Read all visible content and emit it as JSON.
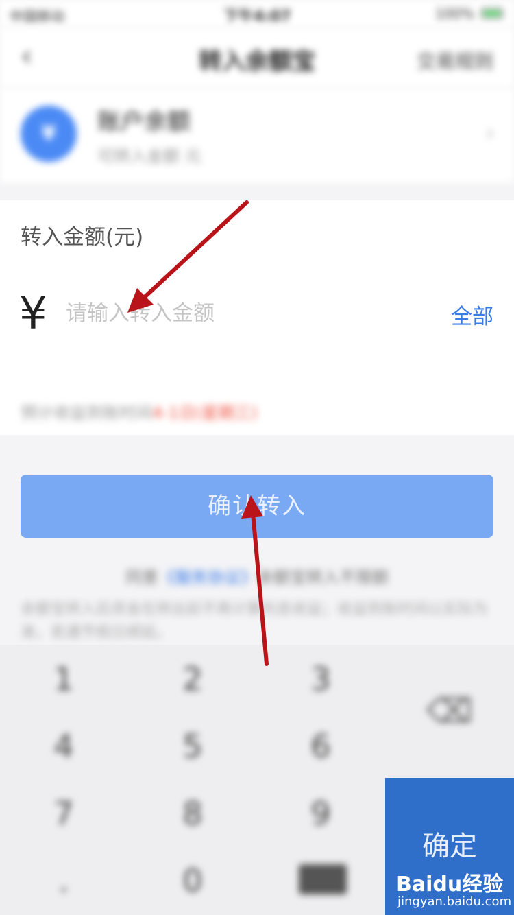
{
  "status_bar": {
    "carrier": "中国移动",
    "time": "下午4:07",
    "battery": "100%"
  },
  "nav": {
    "back_icon": "chevron-left-icon",
    "title": "转入余额宝",
    "right_action": "交易规则"
  },
  "account": {
    "avatar_symbol": "¥",
    "name": "账户余额",
    "subtitle": "可转入金额 元",
    "chevron": "›"
  },
  "amount": {
    "label": "转入金额(元)",
    "currency_symbol": "¥",
    "placeholder": "请输入转入金额",
    "all_label": "全部",
    "tip_text": "预计收益到账时间",
    "tip_highlight": "4-1日(星期三)"
  },
  "confirm_button": {
    "label": "确认转入"
  },
  "agreement": {
    "prefix": "同意",
    "link": "《服务协议》",
    "suffix": "余额宝转入不限额",
    "disclaimer": "余额宝转入后资金在转出前不再计算利息收益；收益到账时间以实际为准，若遇节假日顺延。"
  },
  "keypad": {
    "keys": [
      "1",
      "2",
      "3",
      "4",
      "5",
      "6",
      "7",
      "8",
      "9",
      ".",
      "0"
    ],
    "delete_icon": "backspace-icon",
    "confirm_label": "确定"
  },
  "watermark": {
    "brand_prefix": "Bai",
    "brand_mid": "du",
    "brand_suffix": "经验",
    "site": "jingyan.baidu.com"
  },
  "colors": {
    "accent": "#3a7be8",
    "confirm_button": "#7aa9f4",
    "keypad_confirm": "#2f6fc9",
    "annotation_arrow": "#b8141a",
    "highlight_red": "#f05a4a"
  }
}
